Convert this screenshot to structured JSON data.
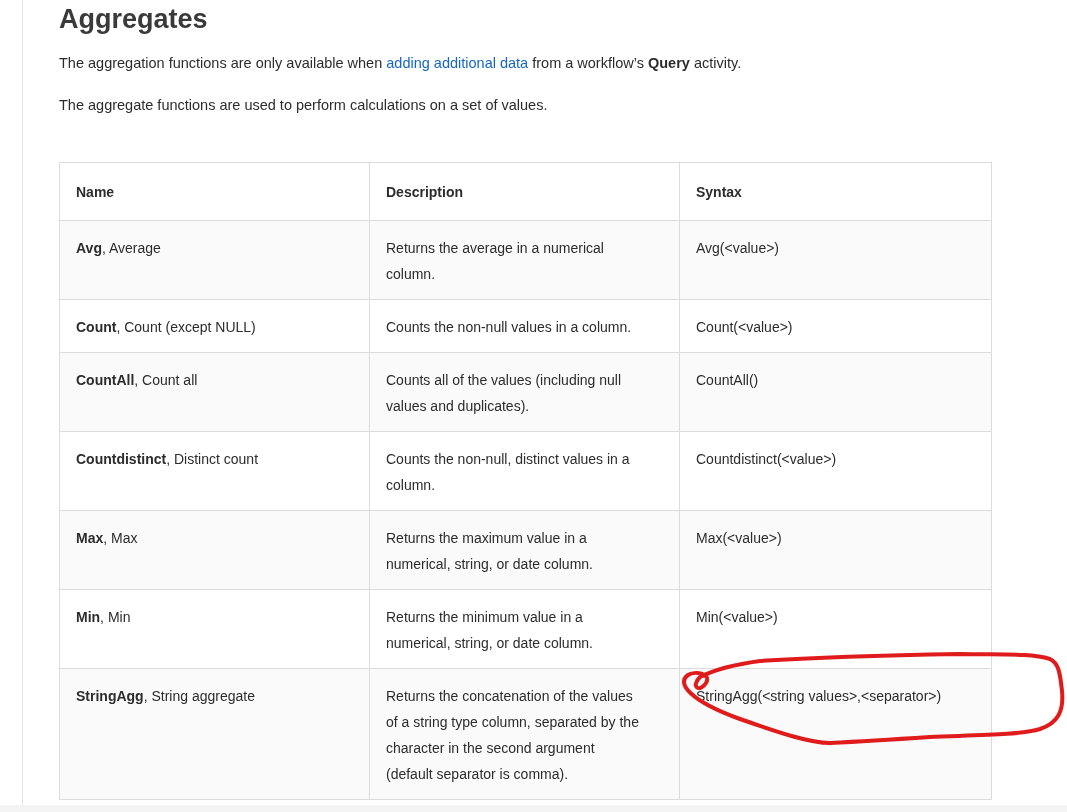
{
  "heading": "Aggregates",
  "intro": {
    "before": "The aggregation functions are only available when ",
    "link": "adding additional data",
    "after": " from a workflow’s **Query** activity."
  },
  "note": "The aggregate functions are used to perform calculations on a set of values.",
  "table": {
    "columns": [
      "Name",
      "Description",
      "Syntax"
    ],
    "rows": [
      {
        "name": "**Avg**, Average",
        "description": "Returns the average in a numerical column.",
        "syntax": "Avg(<value>)"
      },
      {
        "name": "**Count**, Count (except NULL)",
        "description": "Counts the non-null values in a column.",
        "syntax": "Count(<value>)"
      },
      {
        "name": "**CountAll**, Count all",
        "description": "Counts all of the values (including null values and duplicates).",
        "syntax": "CountAll()"
      },
      {
        "name": "**Countdistinct**, Distinct count",
        "description": "Counts the non-null, distinct values in a column.",
        "syntax": "Countdistinct(<value>)"
      },
      {
        "name": "**Max**, Max",
        "description": "Returns the maximum value in a numerical, string, or date column.",
        "syntax": "Max(<value>)"
      },
      {
        "name": "**Min**, Min",
        "description": "Returns the minimum value in a numerical, string, or date column.",
        "syntax": "Min(<value>)"
      },
      {
        "name": "**StringAgg**, String aggregate",
        "description": "Returns the concatenation of the values of a string type column, separated by the character in the second argument (default separator is comma).",
        "syntax": "StringAgg(<string values>,<separator>)"
      }
    ]
  }
}
